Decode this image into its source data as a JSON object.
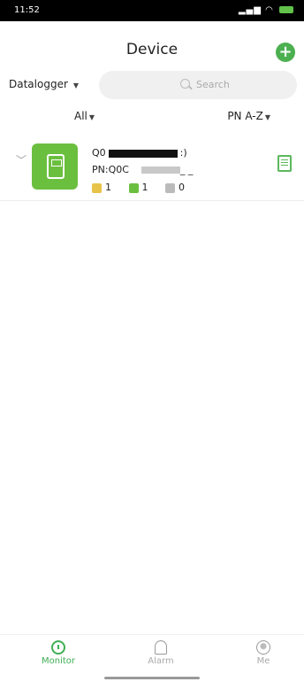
{
  "status_bar": {
    "time": "11:52",
    "battery_label": "100"
  },
  "header": {
    "title": "Device",
    "add_icon": "plus-circle-icon"
  },
  "filter": {
    "device_type": "Datalogger",
    "search_placeholder": "Search"
  },
  "sort": {
    "scope": "All",
    "order": "PN A-Z"
  },
  "devices": [
    {
      "name_prefix": "Q0",
      "name_suffix": ":)",
      "pn_prefix": "PN:Q0C",
      "pn_suffix": "_ _",
      "stats": [
        {
          "icon": "device-yellow-icon",
          "value": "1",
          "color": "#e8c34a"
        },
        {
          "icon": "device-green-icon",
          "value": "1",
          "color": "#6bbf3f"
        },
        {
          "icon": "device-gray-icon",
          "value": "0",
          "color": "#bbbbbb"
        }
      ]
    }
  ],
  "tabs": [
    {
      "label": "Monitor",
      "active": true
    },
    {
      "label": "Alarm",
      "active": false
    },
    {
      "label": "Me",
      "active": false
    }
  ],
  "accent_color": "#3fae55"
}
